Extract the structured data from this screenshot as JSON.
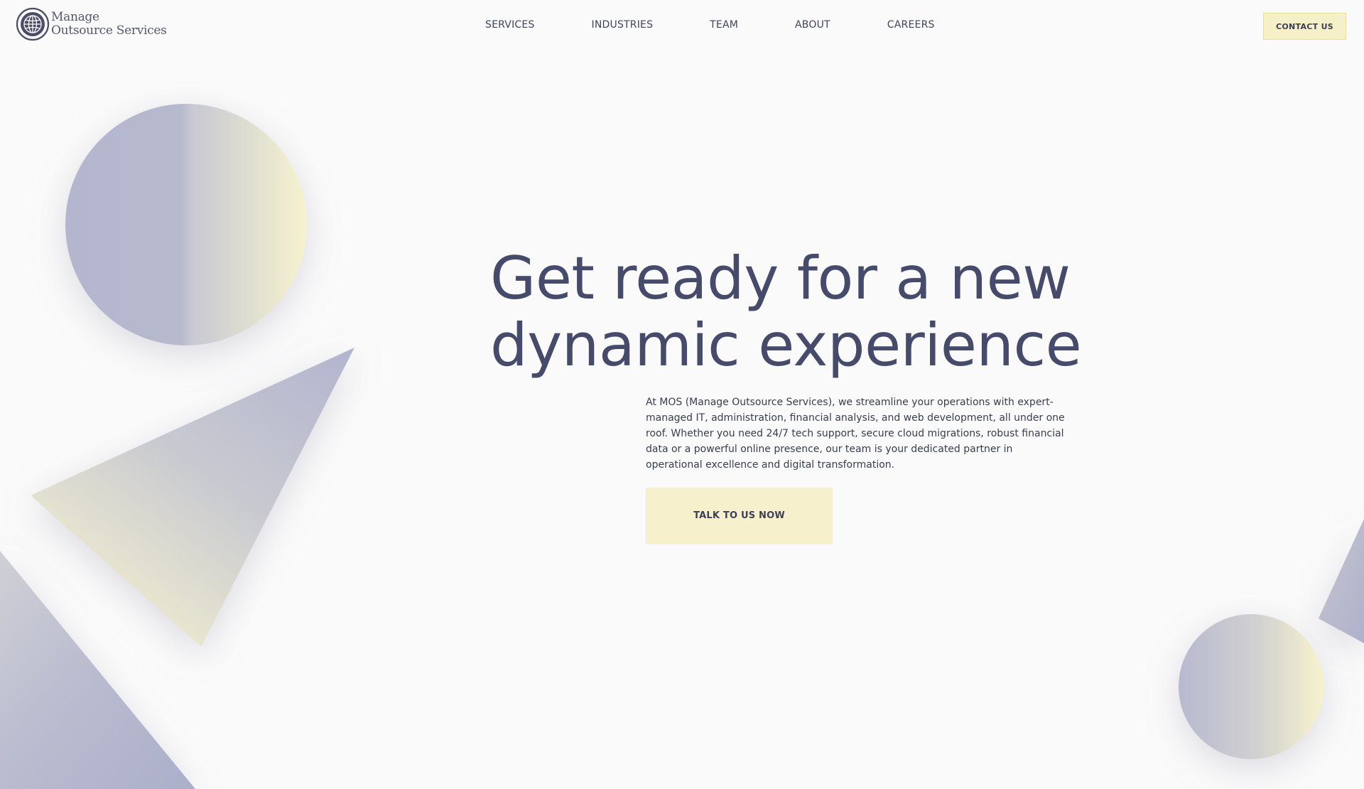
{
  "brand": {
    "logo_icon": "globe-icon",
    "name_line1": "Manage",
    "name_line2": "Outsource Services"
  },
  "nav": {
    "items": [
      {
        "label": "SERVICES"
      },
      {
        "label": "INDUSTRIES"
      },
      {
        "label": "TEAM"
      },
      {
        "label": "ABOUT"
      },
      {
        "label": "CAREERS"
      }
    ],
    "contact_label": "CONTACT US"
  },
  "hero": {
    "title_line1": "Get ready for a new",
    "title_line2": "dynamic experience",
    "description": "At MOS (Manage Outsource Services), we streamline your operations with expert-managed IT, administration, financial analysis, and web development, all under one roof. Whether you need 24/7 tech support, secure cloud migrations, robust financial data or a powerful online presence, our team is your dedicated partner in operational excellence and digital transformation.",
    "cta_label": "TALK TO US NOW"
  },
  "colors": {
    "background": "#fafafa",
    "accent": "#f6f0cc",
    "heading": "#474b6b",
    "shape_lavender": "#b4b7cf",
    "shape_cream": "#f5f1cf"
  }
}
